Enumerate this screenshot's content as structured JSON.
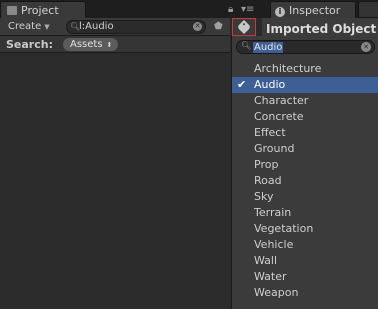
{
  "tabs": {
    "project": "Project",
    "inspector": "Inspector"
  },
  "toolbar": {
    "create_label": "Create",
    "search_value": "l:Audio"
  },
  "search_row": {
    "label": "Search:",
    "scope": "Assets"
  },
  "inspector": {
    "header": "Imported Object"
  },
  "label_popup": {
    "search_value": "Audio",
    "selected": "Audio",
    "items": [
      {
        "label": "Architecture",
        "checked": false
      },
      {
        "label": "Audio",
        "checked": true
      },
      {
        "label": "Character",
        "checked": false
      },
      {
        "label": "Concrete",
        "checked": false
      },
      {
        "label": "Effect",
        "checked": false
      },
      {
        "label": "Ground",
        "checked": false
      },
      {
        "label": "Prop",
        "checked": false
      },
      {
        "label": "Road",
        "checked": false
      },
      {
        "label": "Sky",
        "checked": false
      },
      {
        "label": "Terrain",
        "checked": false
      },
      {
        "label": "Vegetation",
        "checked": false
      },
      {
        "label": "Vehicle",
        "checked": false
      },
      {
        "label": "Wall",
        "checked": false
      },
      {
        "label": "Water",
        "checked": false
      },
      {
        "label": "Weapon",
        "checked": false
      }
    ]
  },
  "colors": {
    "selection": "#3e5f96",
    "highlight_border": "#c83a3a"
  }
}
